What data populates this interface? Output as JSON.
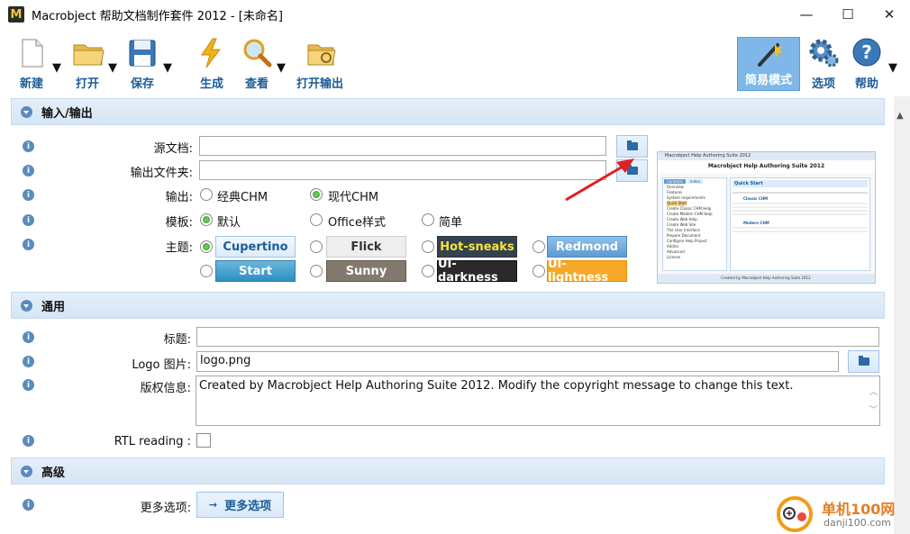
{
  "window": {
    "title": "Macrobject 帮助文档制作套件 2012 - [未命名]",
    "app_icon_letter": "M",
    "minimize_glyph": "—",
    "maximize_glyph": "☐",
    "close_glyph": "✕"
  },
  "toolbar": {
    "new_label": "新建",
    "open_label": "打开",
    "save_label": "保存",
    "build_label": "生成",
    "view_label": "查看",
    "open_output_label": "打开输出",
    "simple_mode_label": "简易模式",
    "options_label": "选项",
    "help_label": "帮助"
  },
  "sections": {
    "io_title": "输入/输出",
    "general_title": "通用",
    "advanced_title": "高级"
  },
  "io": {
    "source_label": "源文档:",
    "source_value": "",
    "output_folder_label": "输出文件夹:",
    "output_folder_value": "",
    "output_label": "输出:",
    "output_options": [
      "经典CHM",
      "现代CHM"
    ],
    "output_selected": "现代CHM",
    "template_label": "模板:",
    "template_options": [
      "默认",
      "Office样式",
      "简单"
    ],
    "template_selected": "默认",
    "theme_label": "主题:",
    "themes": [
      "Cupertino",
      "Flick",
      "Hot-sneaks",
      "Redmond",
      "Start",
      "Sunny",
      "UI-darkness",
      "UI-lightness"
    ],
    "theme_selected": "Cupertino",
    "preview": {
      "window_title": "Macrobject Help Authoring Suite 2012",
      "header": "Macrobject Help Authoring Suite 2012",
      "tab_contents": "Contents",
      "tab_index": "Index",
      "quick_start": "Quick Start",
      "toc": [
        "Overview",
        "Features",
        "System requirements",
        "Quick Start",
        "Create Classic CHM Help",
        "Create Modern CHM Help",
        "Create Web Help",
        "Create Web Site",
        "The User Interface",
        "Prepare Document",
        "Configure Help Project",
        "Addins",
        "Advanced",
        "License"
      ],
      "classic_chm": "Classic CHM",
      "modern_chm": "Modern CHM",
      "footer": "Created by Macrobject Help Authoring Suite 2012."
    }
  },
  "general": {
    "title_label": "标题:",
    "title_value": "",
    "logo_label": "Logo 图片:",
    "logo_value": "logo.png",
    "copyright_label": "版权信息:",
    "copyright_value": "Created by Macrobject Help Authoring Suite 2012. Modify the copyright message to change this text.",
    "rtl_label": "RTL reading :",
    "rtl_checked": false
  },
  "advanced": {
    "more_options_label": "更多选项:",
    "more_options_button": "更多选项"
  },
  "watermark": {
    "name": "单机100网",
    "url": "danji100.com"
  },
  "colors": {
    "accent": "#1d5c99",
    "section_bg": "#dbe8f5",
    "simple_mode_bg": "#7fb7e8"
  }
}
